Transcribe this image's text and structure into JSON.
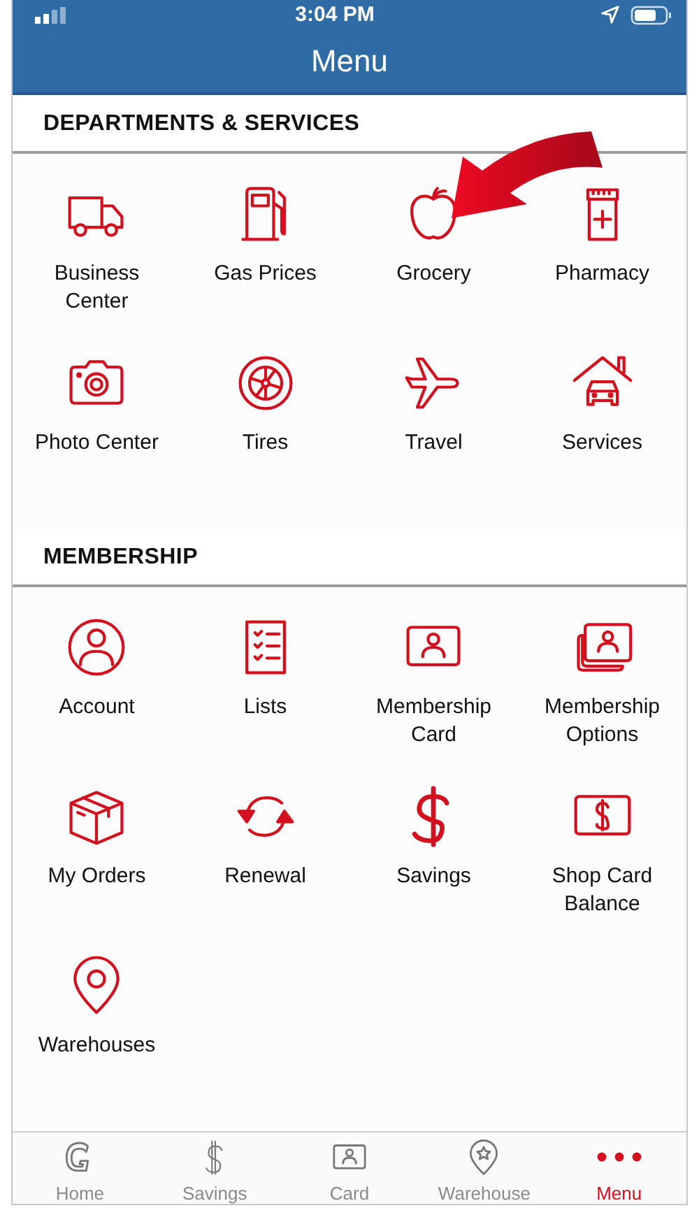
{
  "status_bar": {
    "time": "3:04 PM"
  },
  "header": {
    "title": "Menu"
  },
  "sections": [
    {
      "title": "DEPARTMENTS & SERVICES",
      "items": [
        {
          "label": "Business Center"
        },
        {
          "label": "Gas Prices"
        },
        {
          "label": "Grocery"
        },
        {
          "label": "Pharmacy"
        },
        {
          "label": "Photo Center"
        },
        {
          "label": "Tires"
        },
        {
          "label": "Travel"
        },
        {
          "label": "Services"
        }
      ]
    },
    {
      "title": "MEMBERSHIP",
      "items": [
        {
          "label": "Account"
        },
        {
          "label": "Lists"
        },
        {
          "label": "Membership Card"
        },
        {
          "label": "Membership Options"
        },
        {
          "label": "My Orders"
        },
        {
          "label": "Renewal"
        },
        {
          "label": "Savings"
        },
        {
          "label": "Shop Card Balance"
        },
        {
          "label": "Warehouses"
        }
      ]
    }
  ],
  "tab_bar": [
    {
      "label": "Home",
      "selected": false
    },
    {
      "label": "Savings",
      "selected": false
    },
    {
      "label": "Card",
      "selected": false
    },
    {
      "label": "Warehouse",
      "selected": false
    },
    {
      "label": "Menu",
      "selected": true
    }
  ]
}
